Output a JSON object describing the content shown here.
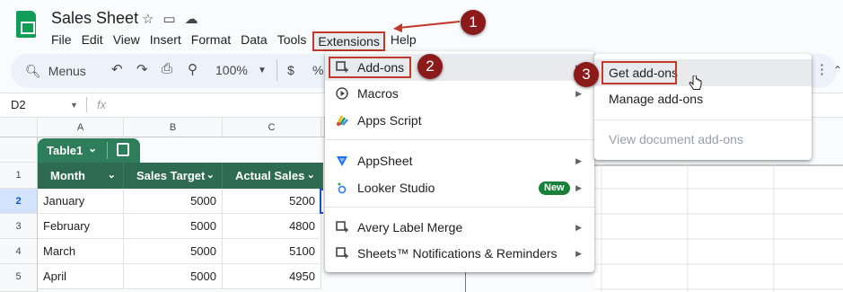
{
  "app": {
    "title": "Sales Sheet",
    "menu": [
      "File",
      "Edit",
      "View",
      "Insert",
      "Format",
      "Data",
      "Tools",
      "Extensions",
      "Help"
    ]
  },
  "toolbar": {
    "search_label": "Menus",
    "zoom": "100%",
    "currency": "$",
    "percent": "%"
  },
  "formula_bar": {
    "cell_ref": "D2",
    "fx": "fx"
  },
  "grid": {
    "columns": [
      "A",
      "B",
      "C"
    ],
    "rows": [
      "1",
      "2",
      "3",
      "4",
      "5"
    ],
    "table_name": "Table1",
    "headers": [
      "Month",
      "Sales Target",
      "Actual Sales"
    ],
    "data": [
      [
        "January",
        "5000",
        "5200"
      ],
      [
        "February",
        "5000",
        "4800"
      ],
      [
        "March",
        "5000",
        "5100"
      ],
      [
        "April",
        "5000",
        "4950"
      ]
    ]
  },
  "extensions_menu": {
    "items": [
      {
        "label": "Add-ons",
        "icon": "add-ons-icon"
      },
      {
        "label": "Macros",
        "icon": "play-circle-icon"
      },
      {
        "label": "Apps Script",
        "icon": "apps-script-icon"
      },
      {
        "label": "AppSheet",
        "icon": "appsheet-icon"
      },
      {
        "label": "Looker Studio",
        "icon": "looker-studio-icon",
        "badge": "New"
      },
      {
        "label": "Avery Label Merge",
        "icon": "add-on-icon"
      },
      {
        "label": "Sheets™ Notifications & Reminders",
        "icon": "add-on-icon"
      }
    ]
  },
  "addons_submenu": {
    "items": [
      "Get add-ons",
      "Manage add-ons",
      "View document add-ons"
    ]
  },
  "markers": [
    "1",
    "2",
    "3"
  ],
  "colors": {
    "accent_red": "#c0392b",
    "marker": "#8b1a1a",
    "table_header": "#2e6b52",
    "new_badge": "#188038"
  }
}
